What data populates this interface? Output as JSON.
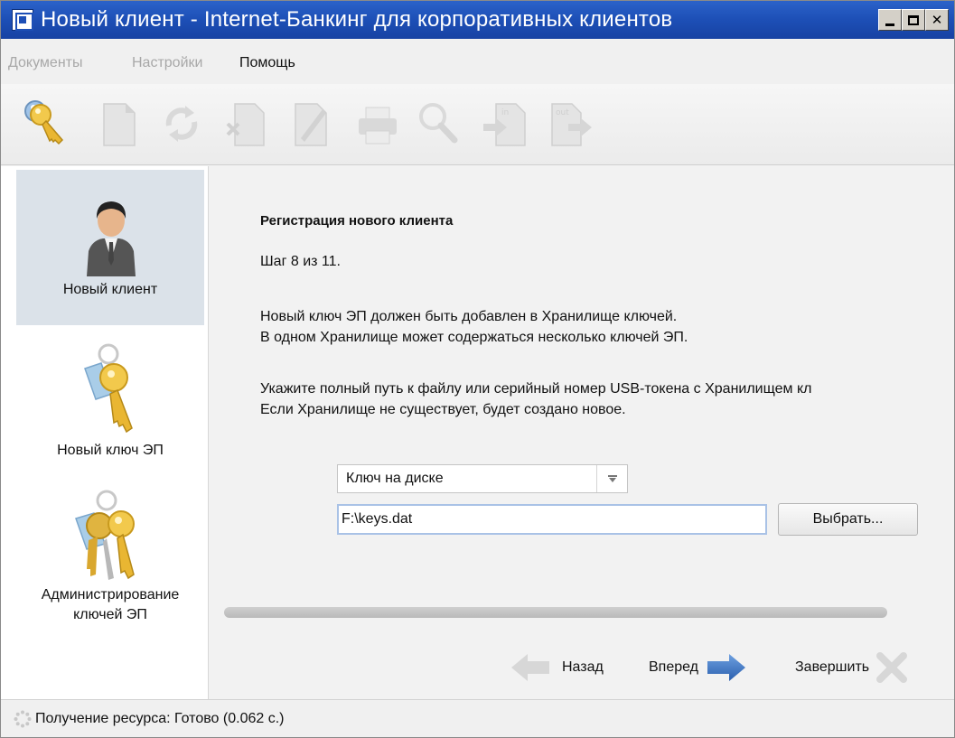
{
  "window": {
    "title": "Новый клиент - Internet-Банкинг для корпоративных клиентов",
    "controls": [
      "minimize",
      "maximize",
      "close"
    ]
  },
  "menu": {
    "items": [
      {
        "label": "Документы",
        "enabled": false
      },
      {
        "label": "Настройки",
        "enabled": false
      },
      {
        "label": "Помощь",
        "enabled": true
      }
    ]
  },
  "toolbar": {
    "icons": [
      "keys-icon",
      "document-icon",
      "refresh-icon",
      "delete-document-icon",
      "edit-document-icon",
      "print-icon",
      "search-icon",
      "import-in-icon",
      "export-out-icon"
    ],
    "import_label": "in",
    "export_label": "out"
  },
  "sidebar": {
    "items": [
      {
        "label": "Новый клиент",
        "icon": "user-icon",
        "active": true
      },
      {
        "label": "Новый ключ ЭП",
        "icon": "key-icon",
        "active": false
      },
      {
        "label": "Администрирование ключей ЭП",
        "label_lines": [
          "Администрирование",
          "ключей ЭП"
        ],
        "icon": "keys-bunch-icon",
        "active": false
      }
    ]
  },
  "wizard": {
    "heading": "Регистрация нового клиента",
    "step": "Шаг 8 из 11.",
    "info_line1": "Новый ключ ЭП должен быть добавлен в Хранилище ключей.",
    "info_line2": "В одном Хранилище может содержаться несколько ключей ЭП.",
    "hint_line1": "Укажите полный путь к файлу или серийный номер USB-токена с Хранилищем кл",
    "hint_line2": "Если Хранилище не существует, будет создано новое.",
    "storage_type": "Ключ на диске",
    "path_value": "F:\\keys.dat",
    "choose_label": "Выбрать...",
    "back_label": "Назад",
    "next_label": "Вперед",
    "finish_label": "Завершить"
  },
  "status": {
    "text": "Получение ресурса: Готово (0.062 с.)"
  },
  "colors": {
    "titlebar": "#1d4fb6",
    "sidebar_active": "#dbe2e9",
    "next_arrow": "#3f76c4",
    "input_focus_border": "#a9c2e6"
  }
}
